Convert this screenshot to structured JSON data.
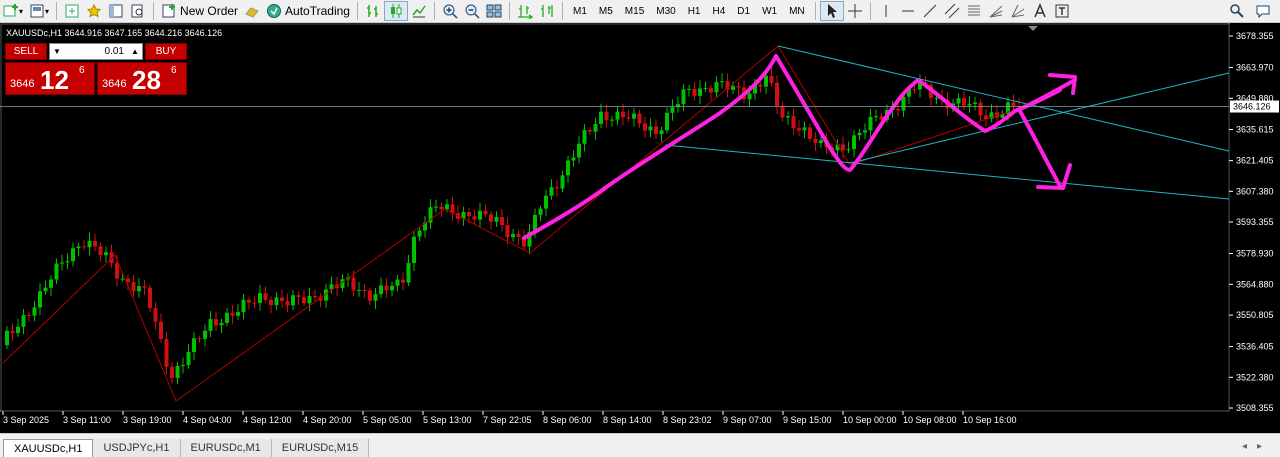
{
  "toolbar": {
    "new_order_label": "New Order",
    "autotrading_label": "AutoTrading",
    "timeframes": [
      "M1",
      "M5",
      "M15",
      "M30",
      "H1",
      "H4",
      "D1",
      "W1",
      "MN"
    ]
  },
  "chart": {
    "symbol_title": "XAUUSDc,H1  3644.916 3647.165 3644.216 3646.126",
    "current_price": "3646.126",
    "price_levels": [
      {
        "label": "3678.355",
        "value": 3678.355
      },
      {
        "label": "3663.970",
        "value": 3663.97
      },
      {
        "label": "3649.880",
        "value": 3649.88
      },
      {
        "label": "3635.615",
        "value": 3635.615
      },
      {
        "label": "3621.405",
        "value": 3621.405
      },
      {
        "label": "3607.380",
        "value": 3607.38
      },
      {
        "label": "3593.355",
        "value": 3593.355
      },
      {
        "label": "3578.930",
        "value": 3578.93
      },
      {
        "label": "3564.880",
        "value": 3564.88
      },
      {
        "label": "3550.805",
        "value": 3550.805
      },
      {
        "label": "3536.405",
        "value": 3536.405
      },
      {
        "label": "3522.380",
        "value": 3522.38
      },
      {
        "label": "3508.355",
        "value": 3508.355
      }
    ],
    "time_labels": [
      "3 Sep 2025",
      "3 Sep 11:00",
      "3 Sep 19:00",
      "4 Sep 04:00",
      "4 Sep 12:00",
      "4 Sep 20:00",
      "5 Sep 05:00",
      "5 Sep 13:00",
      "7 Sep 22:05",
      "8 Sep 06:00",
      "8 Sep 14:00",
      "8 Sep 23:02",
      "9 Sep 07:00",
      "9 Sep 15:00",
      "10 Sep 00:00",
      "10 Sep 08:00",
      "10 Sep 16:00"
    ]
  },
  "trade_panel": {
    "sell_label": "SELL",
    "buy_label": "BUY",
    "lot_value": "0.01",
    "sell_small": "3646",
    "sell_big": "12",
    "sell_sup": "6",
    "buy_small": "3646",
    "buy_big": "28",
    "buy_sup": "6"
  },
  "tabs": [
    "XAUUSDc,H1",
    "USDJPYc,H1",
    "EURUSDc,M1",
    "EURUSDc,M15"
  ],
  "colors": {
    "bull": "#00c000",
    "bear": "#d01010",
    "zigzag": "#b00000",
    "trendline": "#1bb8c8",
    "drawing": "#ff20e0",
    "grid_text": "#ffffff"
  }
}
